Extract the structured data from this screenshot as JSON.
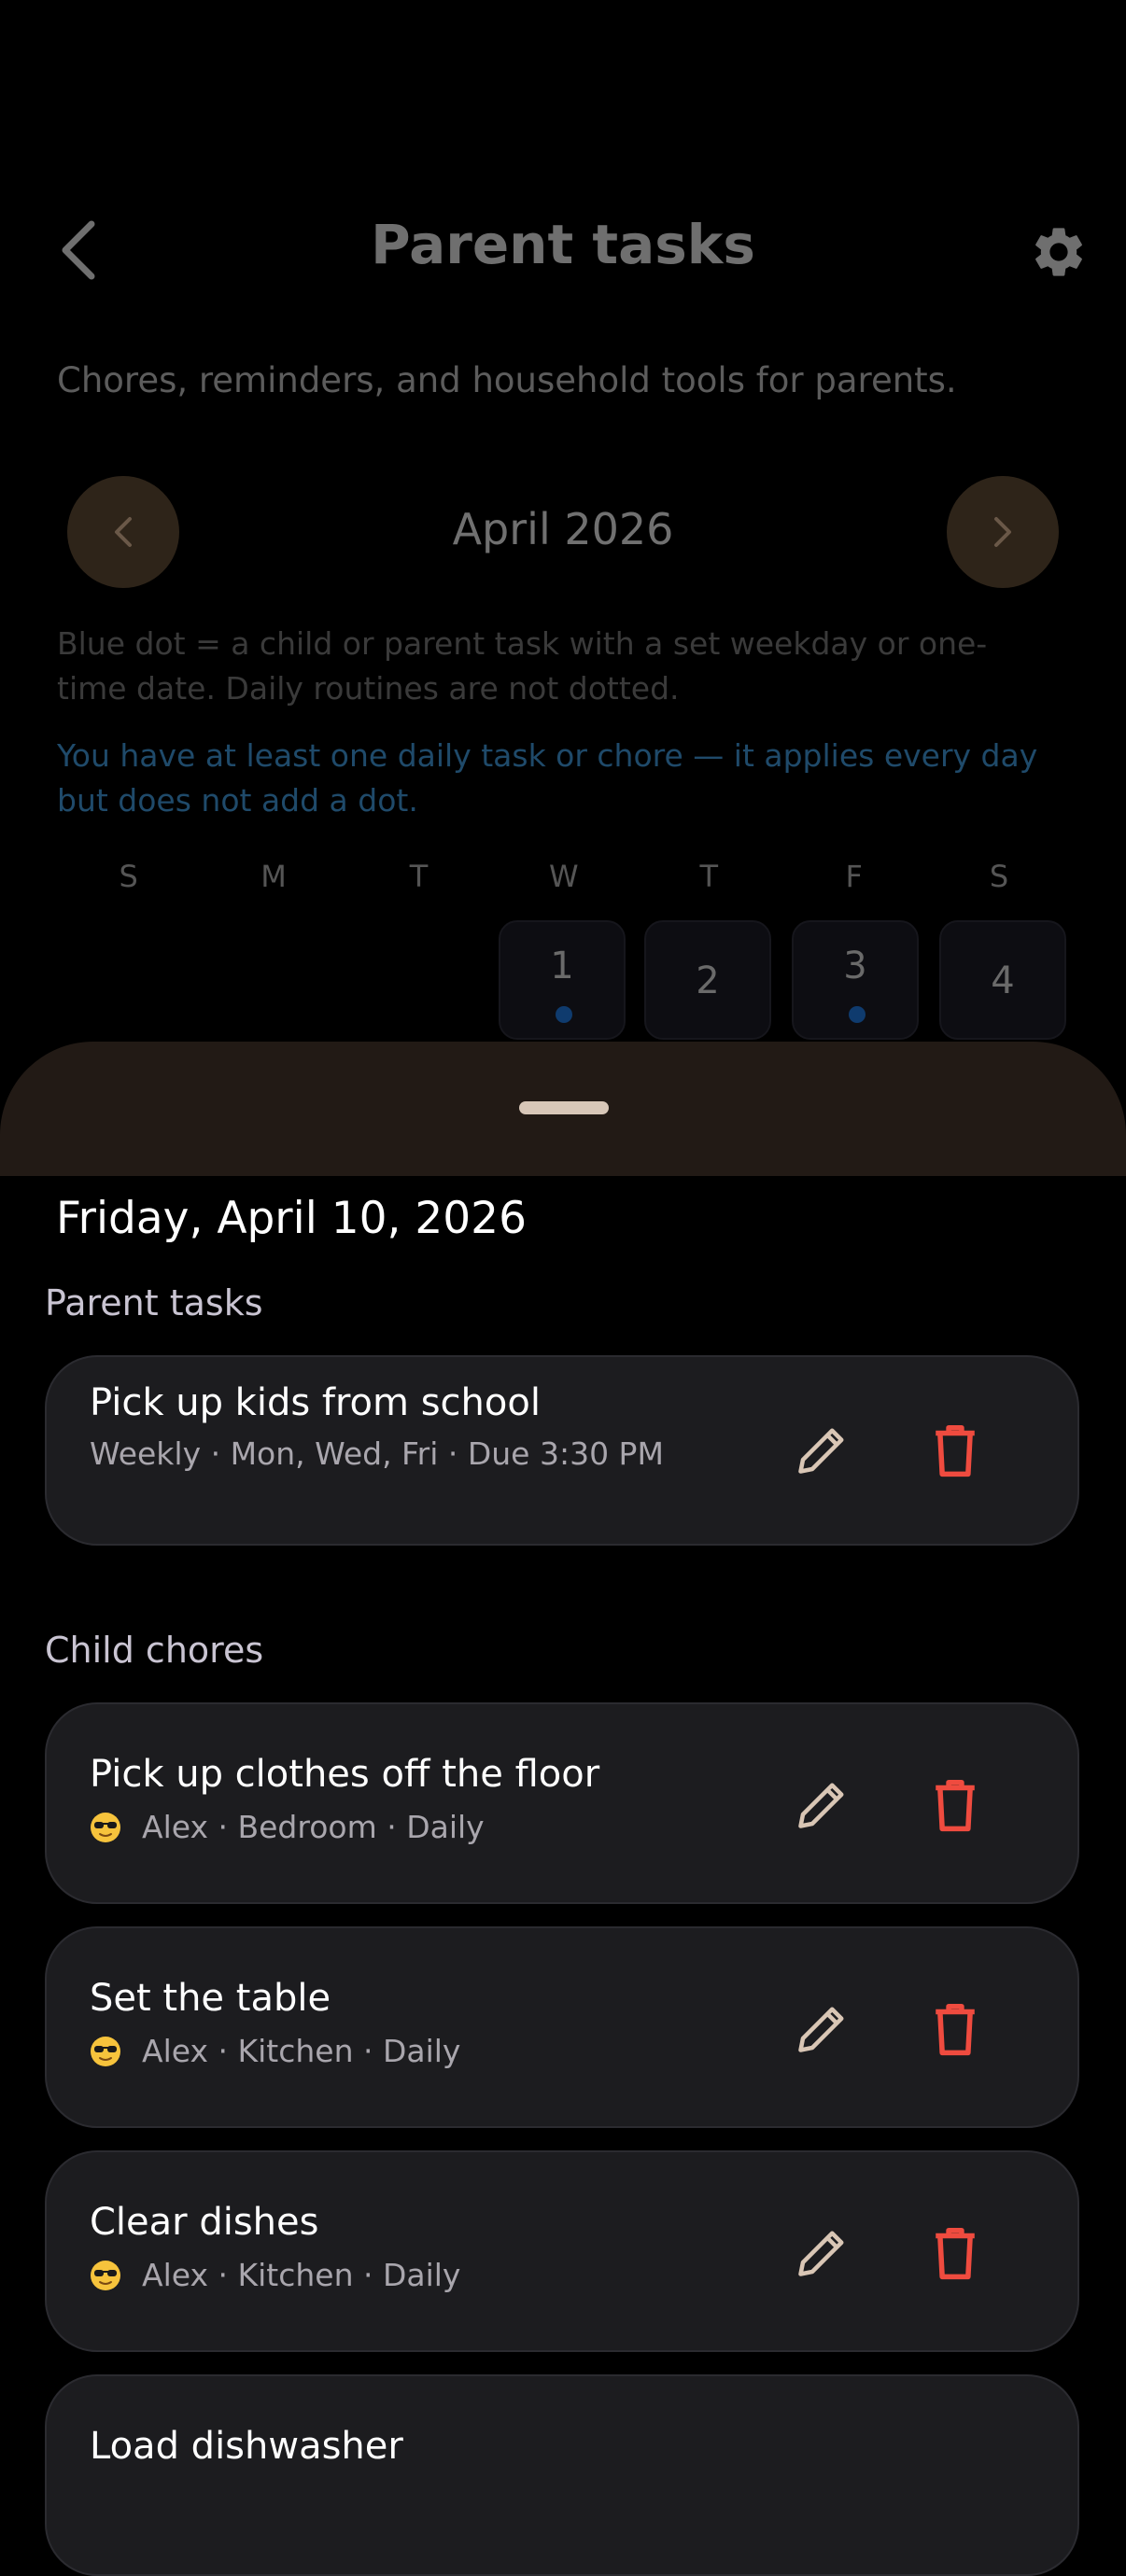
{
  "header": {
    "title": "Parent tasks",
    "subtitle": "Chores, reminders, and household tools for parents."
  },
  "calendar": {
    "month_label": "April 2026",
    "legend_note": "Blue dot = a child or parent task with a set weekday or one-time date. Daily routines are not dotted.",
    "daily_note": "You have at least one daily task or chore — it applies every day but does not add a dot.",
    "weekdays": [
      "S",
      "M",
      "T",
      "W",
      "T",
      "F",
      "S"
    ],
    "days": [
      {
        "num": "1",
        "dot": true
      },
      {
        "num": "2",
        "dot": false
      },
      {
        "num": "3",
        "dot": true
      },
      {
        "num": "4",
        "dot": false
      }
    ],
    "dot_color": "#0f3b6e"
  },
  "sheet": {
    "date_heading": "Friday, April 10, 2026",
    "parent_section_label": "Parent tasks",
    "parent_tasks": [
      {
        "title": "Pick up kids from school",
        "meta": "Weekly · Mon, Wed, Fri · Due 3:30 PM"
      }
    ],
    "child_section_label": "Child chores",
    "child_chores": [
      {
        "title": "Pick up clothes off the floor",
        "meta": "Alex · Bedroom · Daily"
      },
      {
        "title": "Set the table",
        "meta": "Alex · Kitchen · Daily"
      },
      {
        "title": "Clear dishes",
        "meta": "Alex · Kitchen · Daily"
      },
      {
        "title": "Load dishwasher",
        "meta": ""
      }
    ]
  },
  "colors": {
    "accent_delete": "#ef4b3f",
    "accent_edit": "#d9c6b5",
    "sheet_handle_bg": "#221a15",
    "card_bg": "#1c1c1f"
  },
  "icons": {
    "back": "chevron-left-icon",
    "settings": "gear-icon",
    "edit": "pencil-icon",
    "delete": "trash-icon",
    "avatar": "sunglasses-emoji-icon"
  }
}
